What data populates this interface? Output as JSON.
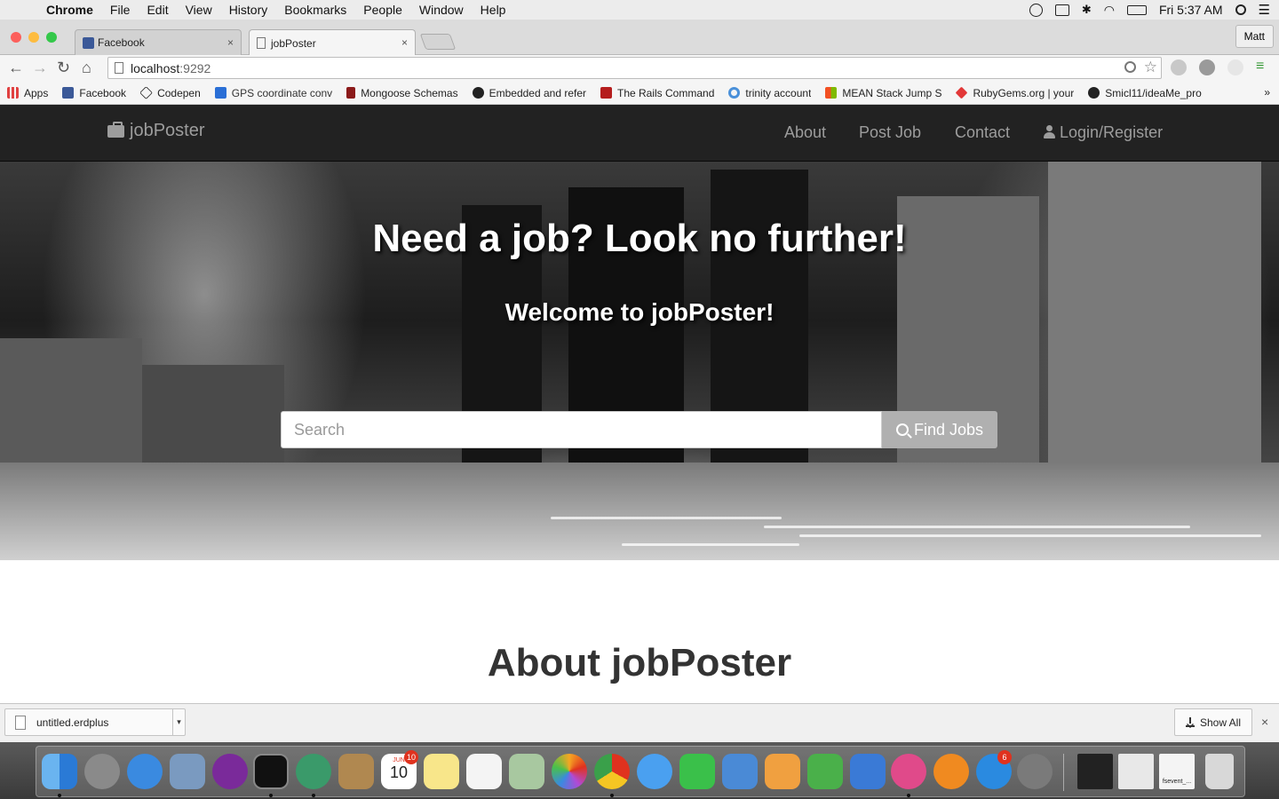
{
  "menubar": {
    "apple": "",
    "items": [
      "Chrome",
      "File",
      "Edit",
      "View",
      "History",
      "Bookmarks",
      "People",
      "Window",
      "Help"
    ],
    "clock": "Fri 5:37 AM"
  },
  "browser": {
    "tabs": [
      {
        "label": "Facebook",
        "close": "×"
      },
      {
        "label": "jobPoster",
        "close": "×"
      }
    ],
    "profile": "Matt",
    "url_host": "localhost",
    "url_port": ":9292",
    "bookmarks": [
      {
        "label": "Apps",
        "color": "#e04040"
      },
      {
        "label": "Facebook",
        "color": "#3b5998"
      },
      {
        "label": "Codepen",
        "color": "#222222"
      },
      {
        "label": "GPS coordinate conv",
        "color": "#2a6fd6"
      },
      {
        "label": "Mongoose Schemas",
        "color": "#8b1a1a"
      },
      {
        "label": "Embedded and refer",
        "color": "#222222"
      },
      {
        "label": "The Rails Command",
        "color": "#b51d1d"
      },
      {
        "label": "trinity account",
        "color": "#4a90d9"
      },
      {
        "label": "MEAN Stack Jump S",
        "color": "#f25022"
      },
      {
        "label": "RubyGems.org | your",
        "color": "#e23838"
      },
      {
        "label": "Smicl11/ideaMe_pro",
        "color": "#222222"
      }
    ],
    "more": "»"
  },
  "site": {
    "brand": "jobPoster",
    "nav": {
      "about": "About",
      "post_job": "Post Job",
      "contact": "Contact",
      "login": "Login/Register"
    },
    "hero": {
      "headline": "Need a job? Look no further!",
      "subheadline": "Welcome to jobPoster!",
      "search_placeholder": "Search",
      "search_button": "Find Jobs"
    },
    "about_title": "About jobPoster"
  },
  "download_shelf": {
    "file_name": "untitled.erdplus",
    "show_all": "Show All",
    "close": "×"
  },
  "dock": {
    "calendar_month": "JUN",
    "calendar_day": "10",
    "calendar_badge": "10",
    "appstore_badge": "6",
    "fsevent_label": "fsevent_..."
  }
}
